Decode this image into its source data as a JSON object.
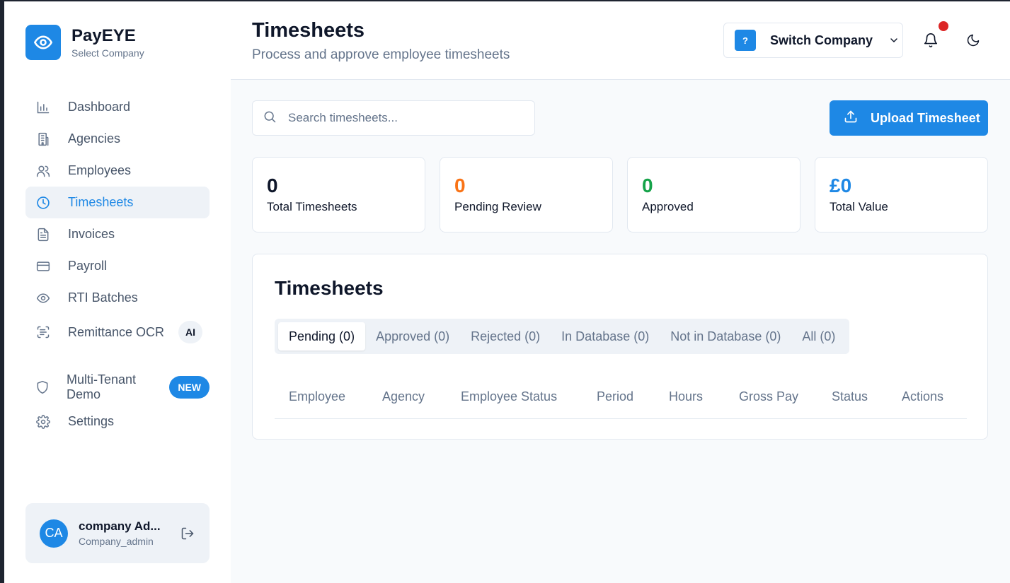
{
  "brand": {
    "name": "PayEYE",
    "subtitle": "Select Company"
  },
  "sidebar": {
    "items": [
      {
        "label": "Dashboard",
        "icon": "bar-chart-icon"
      },
      {
        "label": "Agencies",
        "icon": "building-icon"
      },
      {
        "label": "Employees",
        "icon": "users-icon"
      },
      {
        "label": "Timesheets",
        "icon": "clock-icon",
        "active": true
      },
      {
        "label": "Invoices",
        "icon": "file-text-icon"
      },
      {
        "label": "Payroll",
        "icon": "credit-card-icon"
      },
      {
        "label": "RTI Batches",
        "icon": "eye-icon"
      },
      {
        "label": "Remittance OCR",
        "icon": "scan-text-icon",
        "badge": "AI"
      }
    ],
    "extra_items": [
      {
        "label": "Multi-Tenant Demo",
        "icon": "shield-icon",
        "badge": "NEW"
      },
      {
        "label": "Settings",
        "icon": "gear-icon"
      }
    ]
  },
  "user": {
    "initials": "CA",
    "name": "company Ad...",
    "role": "Company_admin"
  },
  "header": {
    "title": "Timesheets",
    "subtitle": "Process and approve employee timesheets",
    "company_icon_text": "?",
    "switch_company_label": "Switch Company"
  },
  "search": {
    "placeholder": "Search timesheets...",
    "value": ""
  },
  "upload_button": {
    "label": "Upload Timesheet"
  },
  "stats": [
    {
      "value": "0",
      "label": "Total Timesheets",
      "color": "#0f172a"
    },
    {
      "value": "0",
      "label": "Pending Review",
      "color": "#f97316"
    },
    {
      "value": "0",
      "label": "Approved",
      "color": "#16a34a"
    },
    {
      "value": "£0",
      "label": "Total Value",
      "color": "#1e88e5"
    }
  ],
  "panel": {
    "title": "Timesheets",
    "tabs": [
      {
        "label": "Pending (0)",
        "active": true
      },
      {
        "label": "Approved (0)"
      },
      {
        "label": "Rejected (0)"
      },
      {
        "label": "In Database (0)"
      },
      {
        "label": "Not in Database (0)"
      },
      {
        "label": "All (0)"
      }
    ],
    "columns": [
      "Employee",
      "Agency",
      "Employee Status",
      "Period",
      "Hours",
      "Gross Pay",
      "Status",
      "Actions"
    ]
  },
  "colors": {
    "accent": "#1e88e5",
    "notification": "#dc2626"
  }
}
